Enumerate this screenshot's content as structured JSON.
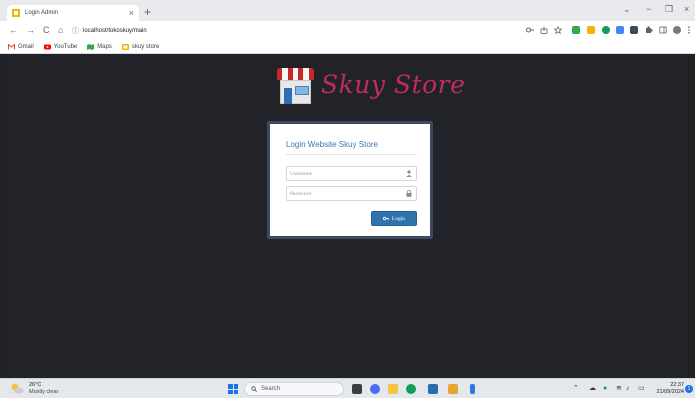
{
  "browser": {
    "tab_title": "Login Admin",
    "tab_close": "×",
    "new_tab": "+",
    "url": "localhost/tokoskuy/main",
    "window_controls": {
      "collapse": "⌄",
      "minimize": "−",
      "restore": "❐",
      "close": "×"
    },
    "nav": {
      "back": "←",
      "forward": "→",
      "reload": "C",
      "home": "⌂",
      "site_info": "ⓘ"
    },
    "bookmarks": [
      {
        "label": "Gmail",
        "color": "#ea4335"
      },
      {
        "label": "YouTube",
        "color": "#ff0000"
      },
      {
        "label": "Maps",
        "color": "#34a853"
      },
      {
        "label": "skuy store",
        "color": "#f4b400"
      }
    ]
  },
  "page": {
    "logo_text": "Skuy Store",
    "logo_colors": {
      "text": "#c02a66",
      "awning_red": "#c62828",
      "awning_white": "#f5f5f5"
    },
    "login": {
      "title": "Login Website Skuy Store",
      "username_placeholder": "Username",
      "password_placeholder": "Password",
      "button_label": "Login"
    },
    "colors": {
      "background": "#212328",
      "accent": "#2f73ad",
      "card_border": "#3b4a5e"
    }
  },
  "taskbar": {
    "weather_temp": "26°C",
    "weather_desc": "Mostly clear",
    "search_label": "Search",
    "time": "22:37",
    "date": "21/09/2024",
    "notification_count": "1"
  }
}
